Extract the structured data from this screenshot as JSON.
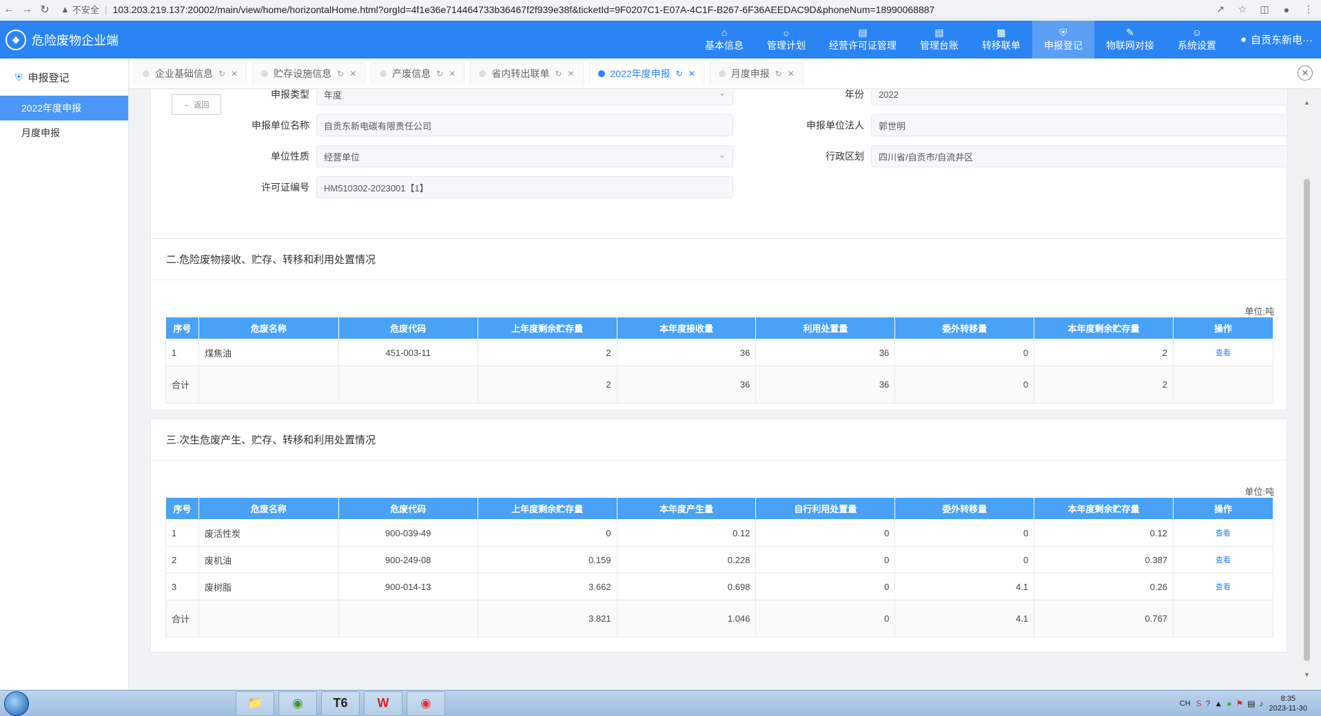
{
  "browser": {
    "security": "不安全",
    "url": "103.203.219.137:20002/main/view/home/horizontalHome.html?orgId=4f1e36e714464733b36467f2f939e38f&ticketId=9F0207C1-E07A-4C1F-B267-6F36AEEDAC9D&phoneNum=18990068887"
  },
  "header": {
    "app_title": "危险废物企业端",
    "menu": [
      {
        "label": "基本信息",
        "icon": "building-icon"
      },
      {
        "label": "管理计划",
        "icon": "plan-icon"
      },
      {
        "label": "经营许可证管理",
        "icon": "license-icon"
      },
      {
        "label": "管理台账",
        "icon": "ledger-icon"
      },
      {
        "label": "转移联单",
        "icon": "truck-icon"
      },
      {
        "label": "申报登记",
        "icon": "shield-icon"
      },
      {
        "label": "物联网对接",
        "icon": "edit-icon"
      },
      {
        "label": "系统设置",
        "icon": "users-icon"
      }
    ],
    "user": "自贡东新电···"
  },
  "sidebar": {
    "title": "申报登记",
    "items": [
      "2022年度申报",
      "月度申报"
    ]
  },
  "tabs": [
    {
      "label": "企业基础信息"
    },
    {
      "label": "贮存设施信息"
    },
    {
      "label": "产废信息"
    },
    {
      "label": "省内转出联单"
    },
    {
      "label": "2022年度申报"
    },
    {
      "label": "月度申报"
    }
  ],
  "form": {
    "back_label": "返回",
    "report_type_label": "申报类型",
    "report_type_value": "年度",
    "year_label": "年份",
    "year_value": "2022",
    "unit_name_label": "申报单位名称",
    "unit_name_value": "自贡东新电碳有限责任公司",
    "legal_person_label": "申报单位法人",
    "legal_person_value": "郭世明",
    "unit_nature_label": "单位性质",
    "unit_nature_value": "经营单位",
    "region_label": "行政区划",
    "region_value": "四川省/自贡市/自流井区",
    "license_label": "许可证编号",
    "license_value": "HM510302-2023001【1】"
  },
  "section2": {
    "title": "二.危险废物接收、贮存、转移和利用处置情况",
    "unit": "单位:吨",
    "headers": [
      "序号",
      "危废名称",
      "危废代码",
      "上年度剩余贮存量",
      "本年度接收量",
      "利用处置量",
      "委外转移量",
      "本年度剩余贮存量",
      "操作"
    ],
    "rows": [
      [
        "1",
        "煤焦油",
        "451-003-11",
        "2",
        "36",
        "36",
        "0",
        "2",
        "查看"
      ]
    ],
    "total": [
      "合计",
      "",
      "",
      "2",
      "36",
      "36",
      "0",
      "2",
      ""
    ]
  },
  "section3": {
    "title": "三.次生危废产生、贮存、转移和利用处置情况",
    "unit": "单位:吨",
    "headers": [
      "序号",
      "危废名称",
      "危废代码",
      "上年度剩余贮存量",
      "本年度产生量",
      "自行利用处置量",
      "委外转移量",
      "本年度剩余贮存量",
      "操作"
    ],
    "rows": [
      [
        "1",
        "废活性炭",
        "900-039-49",
        "0",
        "0.12",
        "0",
        "0",
        "0.12",
        "查看"
      ],
      [
        "2",
        "废机油",
        "900-249-08",
        "0.159",
        "0.228",
        "0",
        "0",
        "0.387",
        "查看"
      ],
      [
        "3",
        "废树脂",
        "900-014-13",
        "3.662",
        "0.698",
        "0",
        "4.1",
        "0.26",
        "查看"
      ]
    ],
    "total": [
      "合计",
      "",
      "",
      "3.821",
      "1.046",
      "0",
      "4.1",
      "0.767",
      ""
    ]
  },
  "taskbar": {
    "apps": [
      "文件夹",
      "浏览器",
      "T6",
      "W",
      "Chrome"
    ],
    "tray_lang": "CH",
    "time": "8:35",
    "date": "2023-11-30"
  }
}
